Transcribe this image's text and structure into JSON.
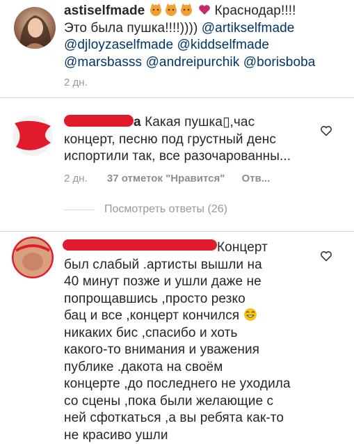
{
  "colors": {
    "text": "#262626",
    "mention": "#003569",
    "meta": "#999999",
    "redaction": "#e11b2b",
    "heart": "#c22a6a",
    "cat_emoji": "#f0a032"
  },
  "post": {
    "username": "astiselfmade",
    "emoji_icons": [
      "cat-emoji",
      "cat-emoji",
      "cat-emoji",
      "heart-emoji"
    ],
    "caption_head": "Краснодар!!!!",
    "line2_text": "Это была пушка!!!!)))) ",
    "mentions": [
      "@artikselfmade",
      "@djloyzaselfmade",
      "@kiddselfmade",
      "@marsbasss",
      "@andreipurchik",
      "@borisboba"
    ],
    "time": "2 дн."
  },
  "comment1": {
    "username_tail": "a",
    "lines": [
      "Какая пушка▯,час",
      "концерт, песню под грустный денс",
      "испортили так, все разочарованны..."
    ],
    "time": "2 дн.",
    "likes": "37 отметок \"Нравится\"",
    "reply": "Отв..."
  },
  "view_replies": "Посмотреть ответы (26)",
  "comment2": {
    "line0": "Концерт",
    "lines": [
      "был слабый .артисты вышли на",
      "40 минут позже и ушли даже не",
      "попрощавшись ,просто резко",
      "бац и все ,концерт кончился",
      "никаких бис ,спасибо и хоть",
      "какого-то внимания и уважения",
      "публике .дакота на своём",
      "концерте ,до последнего не уходила",
      "со сцены ,пока были желающие с",
      "ней сфоткаться ,а вы ребята как-то",
      "не красиво ушли"
    ],
    "emoji_icon": "smiling-face-emoji"
  }
}
